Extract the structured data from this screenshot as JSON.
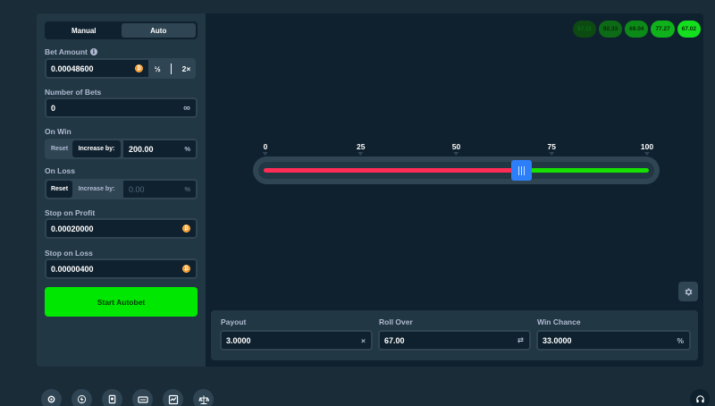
{
  "sidebar": {
    "tabs": [
      "Manual",
      "Auto"
    ],
    "active_tab": 1,
    "bet_amount": {
      "label": "Bet Amount",
      "value": "0.00048600",
      "half": "½",
      "double": "2×"
    },
    "number_of_bets": {
      "label": "Number of Bets",
      "value": "0",
      "suffix": "∞"
    },
    "on_win": {
      "label": "On Win",
      "reset": "Reset",
      "increase": "Increase by:",
      "value": "200.00",
      "suffix": "%"
    },
    "on_loss": {
      "label": "On Loss",
      "reset": "Reset",
      "increase": "Increase by:",
      "value": "0.00",
      "suffix": "%"
    },
    "stop_on_profit": {
      "label": "Stop on Profit",
      "value": "0.00020000"
    },
    "stop_on_loss": {
      "label": "Stop on Loss",
      "value": "0.00000400"
    },
    "start_button": "Start Autobet"
  },
  "history": [
    {
      "text": "57.11",
      "color": "#0c4a12",
      "text_color": "#0a6e14"
    },
    {
      "text": "92.33",
      "color": "#0d6a16",
      "text_color": "#0a2a0a"
    },
    {
      "text": "69.04",
      "color": "#0c8a18",
      "text_color": "#0a2a0a"
    },
    {
      "text": "77.27",
      "color": "#0fb21b",
      "text_color": "#0a2a0a"
    },
    {
      "text": "67.02",
      "color": "#14df1f",
      "text_color": "#0a2a0a"
    }
  ],
  "slider": {
    "ticks": [
      "0",
      "25",
      "50",
      "75",
      "100"
    ],
    "value": 67,
    "lose_color": "#ff2d55",
    "win_color": "#16e100",
    "handle_color": "#2d7ff9"
  },
  "stats": {
    "payout": {
      "label": "Payout",
      "value": "3.0000",
      "symbol": "×"
    },
    "roll_over": {
      "label": "Roll Over",
      "value": "67.00",
      "symbol": "⇄"
    },
    "win_chance": {
      "label": "Win Chance",
      "value": "33.0000",
      "symbol": "%"
    }
  },
  "icons": {
    "gear": "gear-icon",
    "footer": [
      "settings-icon",
      "lightning-icon",
      "book-icon",
      "keyboard-icon",
      "chart-icon",
      "balance-icon"
    ],
    "support": "headset-icon",
    "coin": "bitcoin-icon"
  },
  "colors": {
    "accent": "#00e701",
    "background": "#1a2c38",
    "panel": "#213743",
    "input": "#0f212e"
  }
}
